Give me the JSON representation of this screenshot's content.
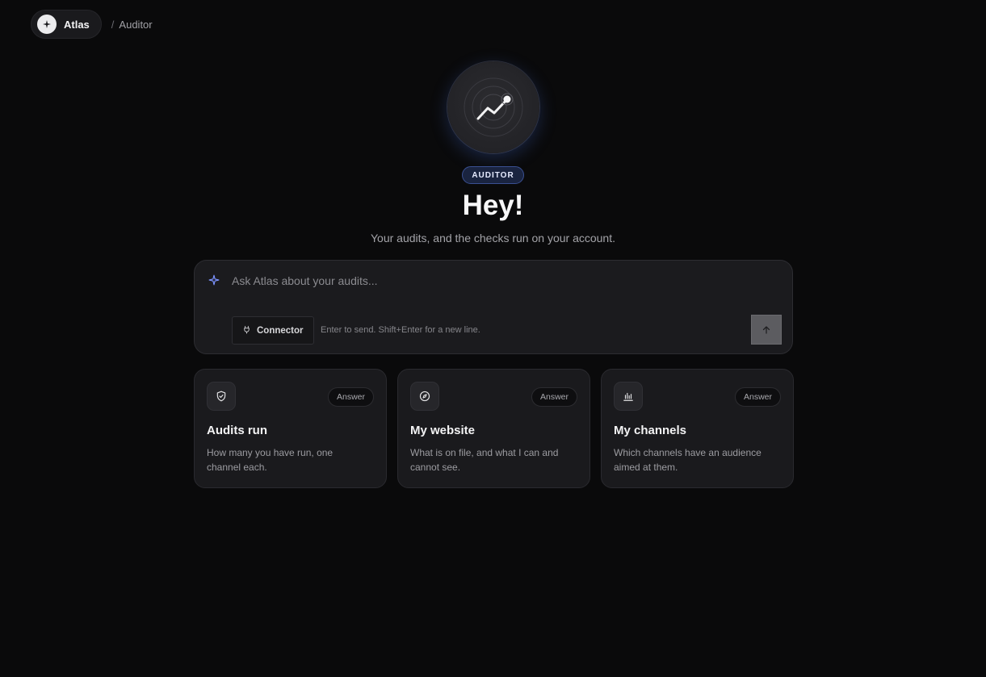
{
  "header": {
    "brand_name": "Atlas",
    "breadcrumb_sep": "/",
    "breadcrumb_current": "Auditor"
  },
  "hero": {
    "icon": "trending-chart-icon",
    "badge": "AUDITOR",
    "title": "Hey!",
    "subtitle": "Your audits, and the checks run on your account."
  },
  "composer": {
    "placeholder": "Ask Atlas about your audits...",
    "connector_label": "Connector",
    "hint": "Enter to send. Shift+Enter for a new line.",
    "send_icon": "arrow-up-icon"
  },
  "cards": [
    {
      "icon": "shield-check-icon",
      "badge": "Answer",
      "title": "Audits run",
      "description": "How many you have run, one channel each."
    },
    {
      "icon": "compass-icon",
      "badge": "Answer",
      "title": "My website",
      "description": "What is on file, and what I can and cannot see."
    },
    {
      "icon": "bar-chart-icon",
      "badge": "Answer",
      "title": "My channels",
      "description": "Which channels have an audience aimed at them."
    }
  ],
  "colors": {
    "background": "#0a0a0b",
    "badge_accent": "#3a5092",
    "spark_accent": "#7c93ff"
  }
}
